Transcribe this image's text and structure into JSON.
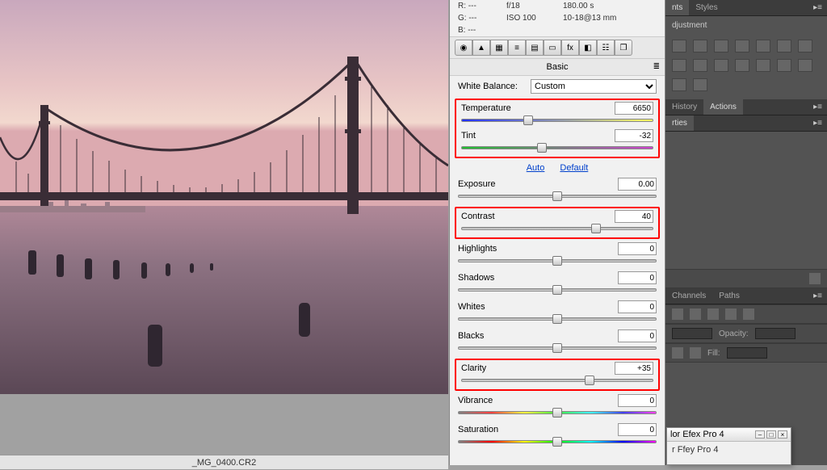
{
  "filename": "_MG_0400.CR2",
  "readout": {
    "R": "---",
    "G": "---",
    "B": "---",
    "aperture": "f/18",
    "shutter": "180.00 s",
    "iso": "ISO 100",
    "focal": "10-18@13 mm"
  },
  "section_title": "Basic",
  "wb_label": "White Balance:",
  "wb_value": "Custom",
  "links": {
    "auto": "Auto",
    "default": "Default"
  },
  "sliders": {
    "temperature": {
      "label": "Temperature",
      "value": "6650",
      "pos": 35,
      "track": "temp",
      "highlight": "group1"
    },
    "tint": {
      "label": "Tint",
      "value": "-32",
      "pos": 42,
      "track": "tint",
      "highlight": "group1"
    },
    "exposure": {
      "label": "Exposure",
      "value": "0.00",
      "pos": 50,
      "track": "plain"
    },
    "contrast": {
      "label": "Contrast",
      "value": "40",
      "pos": 70,
      "track": "plain",
      "highlight": "solo"
    },
    "highlights": {
      "label": "Highlights",
      "value": "0",
      "pos": 50,
      "track": "plain"
    },
    "shadows": {
      "label": "Shadows",
      "value": "0",
      "pos": 50,
      "track": "plain"
    },
    "whites": {
      "label": "Whites",
      "value": "0",
      "pos": 50,
      "track": "plain"
    },
    "blacks": {
      "label": "Blacks",
      "value": "0",
      "pos": 50,
      "track": "plain"
    },
    "clarity": {
      "label": "Clarity",
      "value": "+35",
      "pos": 67,
      "track": "plain",
      "highlight": "solo"
    },
    "vibrance": {
      "label": "Vibrance",
      "value": "0",
      "pos": 50,
      "track": "vibrance"
    },
    "saturation": {
      "label": "Saturation",
      "value": "0",
      "pos": 50,
      "track": "saturation"
    }
  },
  "right": {
    "tabs1": {
      "a": "nts",
      "b": "Styles",
      "heading": "djustment"
    },
    "tabs2": {
      "a": "History",
      "b": "Actions"
    },
    "tabs2b": {
      "a": "rties"
    },
    "tabs3": {
      "a": "Channels",
      "b": "Paths"
    },
    "opacity": "Opacity:",
    "fill": "Fill:"
  },
  "plugin": {
    "title": "lor Efex Pro 4",
    "body": "r Ffey Pro 4"
  }
}
